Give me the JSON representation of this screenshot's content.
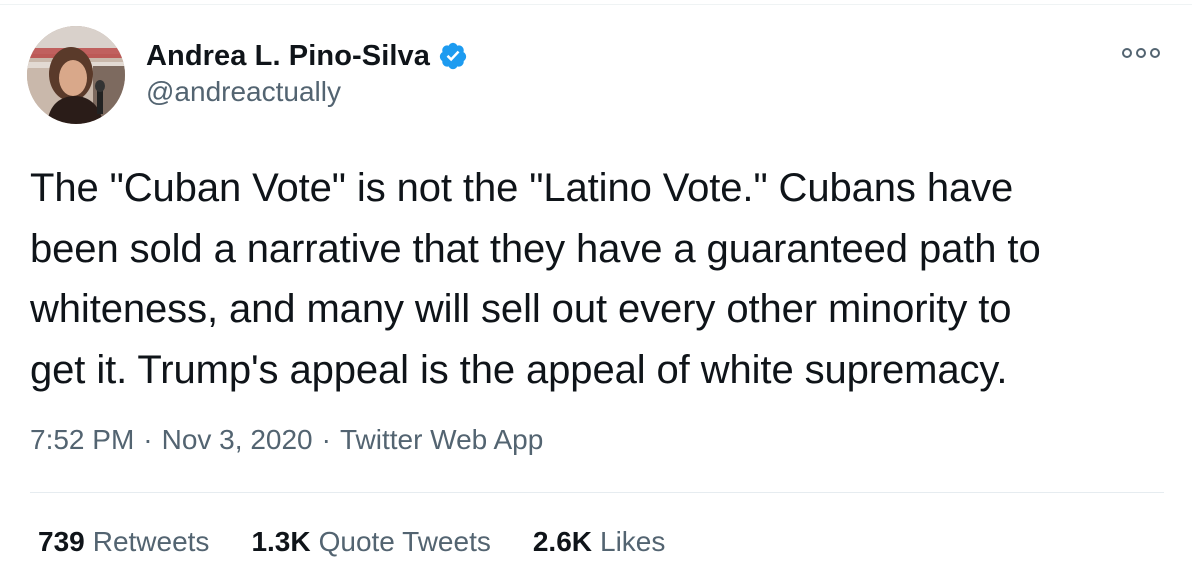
{
  "author": {
    "display_name": "Andrea L. Pino-Silva",
    "handle": "@andreactually",
    "verified": true,
    "avatar_icon": "profile-photo"
  },
  "tweet": {
    "text": "The \"Cuban Vote\" is not the \"Latino Vote.\" Cubans have\nbeen sold a narrative that they have a guaranteed path to\nwhiteness, and many will sell out every other minority to\nget it. Trump's appeal is the appeal of white supremacy."
  },
  "meta": {
    "time": "7:52 PM",
    "separator": "·",
    "date": "Nov 3, 2020",
    "source": "Twitter Web App"
  },
  "stats": {
    "retweets": {
      "count": "739",
      "label": "Retweets"
    },
    "quotes": {
      "count": "1.3K",
      "label": "Quote Tweets"
    },
    "likes": {
      "count": "2.6K",
      "label": "Likes"
    }
  },
  "icons": {
    "verified": "verified-badge-icon",
    "more": "more-options-icon"
  },
  "colors": {
    "text_primary": "#0f1419",
    "text_secondary": "#536471",
    "verified_blue": "#1d9bf0",
    "divider": "#e6ecf0"
  }
}
